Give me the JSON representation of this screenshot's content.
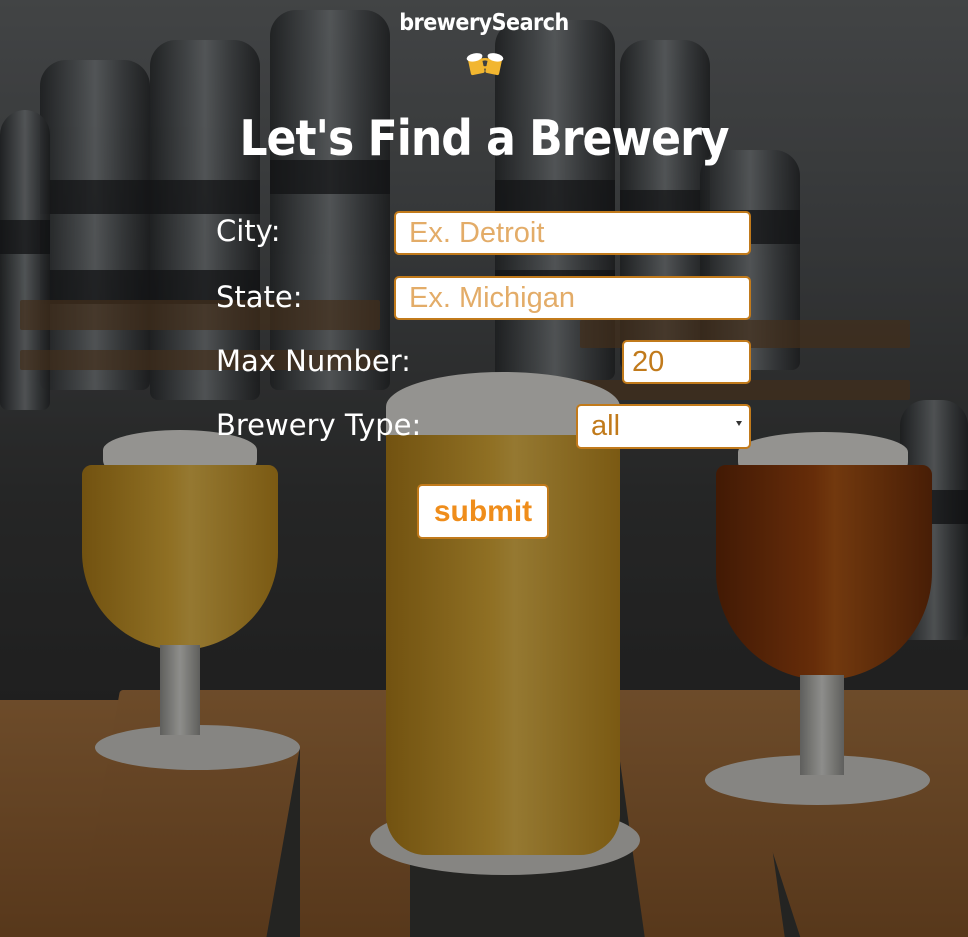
{
  "brand": {
    "title": "brewerySearch",
    "icon": "beer-mugs-icon"
  },
  "heading": "Let's Find a Brewery",
  "form": {
    "city": {
      "label": "City:",
      "placeholder": "Ex. Detroit",
      "value": ""
    },
    "state": {
      "label": "State:",
      "placeholder": "Ex. Michigan",
      "value": ""
    },
    "max_number": {
      "label": "Max Number:",
      "value": "20"
    },
    "brewery_type": {
      "label": "Brewery Type:",
      "selected": "all"
    },
    "submit_label": "submit"
  },
  "colors": {
    "accent": "#c17a1b",
    "button_text": "#ef8d1b",
    "placeholder": "#e3ac68",
    "text": "#ffffff"
  }
}
